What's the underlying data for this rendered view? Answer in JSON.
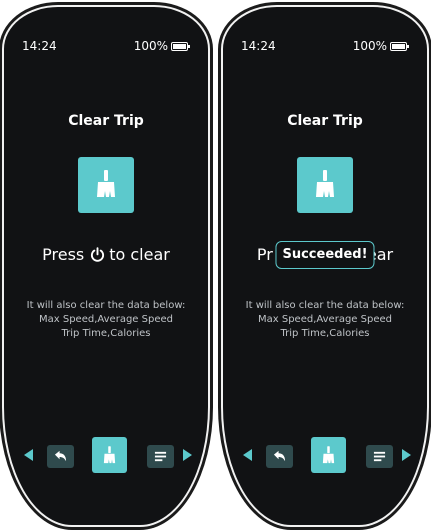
{
  "screens": [
    {
      "status": {
        "time": "14:24",
        "battery": "100%"
      },
      "title": "Clear Trip",
      "press_text": "Press",
      "clear_text": "to clear",
      "info": [
        "It will also clear the data below:",
        "Max Speed,Average Speed",
        "Trip Time,Calories"
      ]
    },
    {
      "status": {
        "time": "14:24",
        "battery": "100%"
      },
      "title": "Clear Trip",
      "press_text": "Pr",
      "clear_text": "ear",
      "toast": "Succeeded!",
      "info": [
        "It will also clear the data below:",
        "Max Speed,Average Speed",
        "Trip Time,Calories"
      ]
    }
  ],
  "colors": {
    "accent": "#5cc9cc",
    "background": "#111214",
    "button_dark": "#2f4a4d"
  },
  "icons": {
    "clean": "broom-icon",
    "power": "power-icon",
    "back": "back-arrow-icon",
    "menu": "menu-icon"
  }
}
